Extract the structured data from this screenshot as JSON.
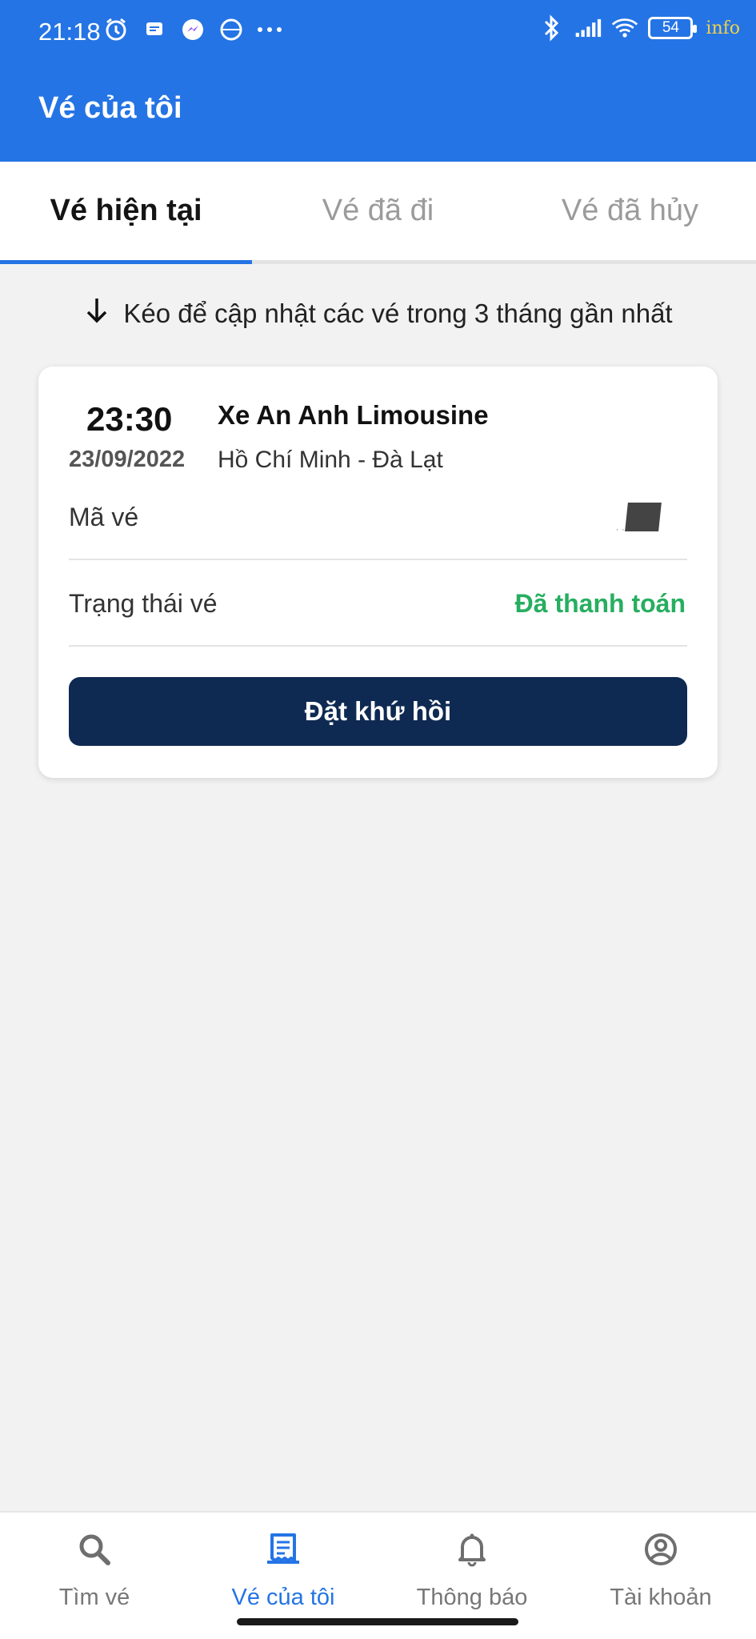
{
  "status_bar": {
    "time": "21:18",
    "battery": "54",
    "watermark": "info",
    "left_icons": [
      "alarm-icon",
      "message-icon",
      "messenger-icon",
      "globe-icon",
      "more-dots-icon"
    ],
    "right_icons": [
      "bluetooth-icon",
      "signal-icon",
      "wifi-icon",
      "battery-icon"
    ]
  },
  "header": {
    "title": "Vé của tôi"
  },
  "tabs": [
    {
      "label": "Vé hiện tại",
      "active": true
    },
    {
      "label": "Vé đã đi",
      "active": false
    },
    {
      "label": "Vé đã hủy",
      "active": false
    }
  ],
  "refresh_hint": {
    "icon": "arrow-down-icon",
    "text": "Kéo để cập nhật các vé trong 3 tháng gần nhất"
  },
  "ticket": {
    "time": "23:30",
    "date": "23/09/2022",
    "operator": "Xe An Anh Limousine",
    "route": "Hồ Chí Minh - Đà Lạt",
    "code_label": "Mã vé",
    "status_label": "Trạng thái vé",
    "status_value": "Đã thanh toán",
    "status_color": "#27ae60",
    "return_button": "Đặt khứ hồi"
  },
  "bottom_nav": [
    {
      "label": "Tìm vé",
      "icon": "search-icon",
      "active": false
    },
    {
      "label": "Vé của tôi",
      "icon": "ticket-icon",
      "active": true
    },
    {
      "label": "Thông báo",
      "icon": "bell-icon",
      "active": false
    },
    {
      "label": "Tài khoản",
      "icon": "account-icon",
      "active": false
    }
  ],
  "colors": {
    "primary": "#2474e5",
    "dark_button": "#0f2a52",
    "success": "#27ae60"
  }
}
